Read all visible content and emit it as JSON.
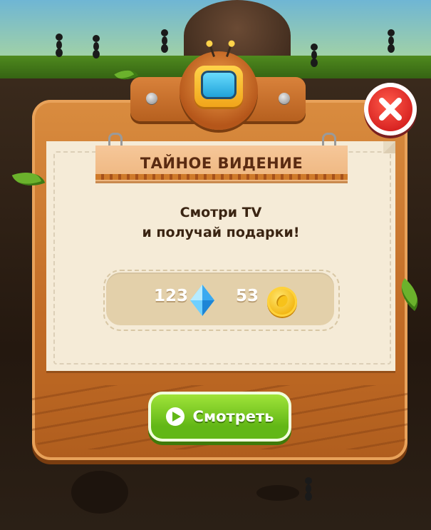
{
  "dialog": {
    "title": "ТАЙНОЕ ВИДЕНИЕ",
    "subtitle_line1": "Смотри TV",
    "subtitle_line2": "и получай подарки!",
    "rewards": {
      "gems": "123",
      "coins": "53"
    },
    "watch_button_label": "Смотреть"
  },
  "icons": {
    "header": "tv-icon",
    "close": "close-icon",
    "gem": "gem-icon",
    "coin": "coin-icon",
    "play": "play-icon"
  },
  "colors": {
    "close_red": "#d31d1d",
    "watch_green": "#62b716",
    "board_orange": "#c26c26",
    "title_text": "#5a2b12"
  }
}
